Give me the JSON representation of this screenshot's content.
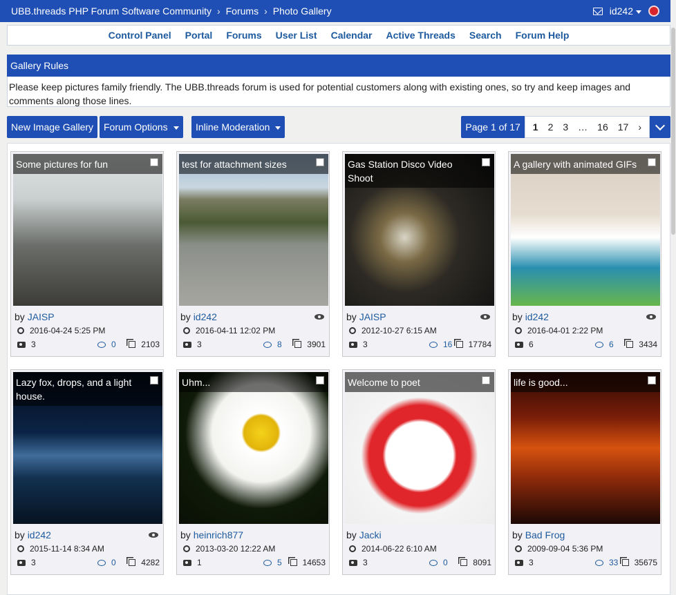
{
  "breadcrumb": [
    "UBB.threads PHP Forum Software Community",
    "Forums",
    "Photo Gallery"
  ],
  "user": {
    "name": "id242"
  },
  "nav": [
    "Control Panel",
    "Portal",
    "Forums",
    "User List",
    "Calendar",
    "Active Threads",
    "Search",
    "Forum Help"
  ],
  "rules": {
    "title": "Gallery Rules",
    "text": "Please keep pictures family friendly. The UBB.threads forum is used for potential customers along with existing ones, so try and keep images and comments along those lines."
  },
  "toolbar": {
    "new_gallery": "New Image Gallery",
    "forum_options": "Forum Options",
    "inline_moderation": "Inline Moderation"
  },
  "pager": {
    "label": "Page 1 of 17",
    "pages": [
      "1",
      "2",
      "3",
      "…",
      "16",
      "17",
      "›"
    ]
  },
  "galleries": [
    {
      "title": "Some pictures for fun",
      "by_prefix": "by",
      "author": "JAISP",
      "date": "2016-04-24 5:25 PM",
      "images": "3",
      "replies": "0",
      "views": "2103",
      "viewed": false
    },
    {
      "title": "test for attachment sizes",
      "by_prefix": "by",
      "author": "id242",
      "date": "2016-04-11 12:02 PM",
      "images": "3",
      "replies": "8",
      "views": "3901",
      "viewed": true
    },
    {
      "title": "Gas Station Disco Video Shoot",
      "by_prefix": "by",
      "author": "JAISP",
      "date": "2012-10-27 6:15 AM",
      "images": "3",
      "replies": "16",
      "views": "17784",
      "viewed": true
    },
    {
      "title": "A gallery with animated GIFs",
      "by_prefix": "by",
      "author": "id242",
      "date": "2016-04-01 2:22 PM",
      "images": "6",
      "replies": "6",
      "views": "3434",
      "viewed": true
    },
    {
      "title": "Lazy fox, drops, and a light house.",
      "by_prefix": "by",
      "author": "id242",
      "date": "2015-11-14 8:34 AM",
      "images": "3",
      "replies": "0",
      "views": "4282",
      "viewed": true
    },
    {
      "title": "Uhm...",
      "by_prefix": "by",
      "author": "heinrich877",
      "date": "2013-03-20 12:22 AM",
      "images": "1",
      "replies": "5",
      "views": "14653",
      "viewed": false
    },
    {
      "title": "Welcome to poet",
      "by_prefix": "by",
      "author": "Jacki",
      "date": "2014-06-22 6:10 AM",
      "images": "3",
      "replies": "0",
      "views": "8091",
      "viewed": false
    },
    {
      "title": "life is good...",
      "by_prefix": "by",
      "author": "Bad Frog",
      "date": "2009-09-04 5:36 PM",
      "images": "3",
      "replies": "33",
      "views": "35675",
      "viewed": false
    }
  ],
  "colors": {
    "brand": "#1f4fb5",
    "link": "#1d5a9e"
  }
}
